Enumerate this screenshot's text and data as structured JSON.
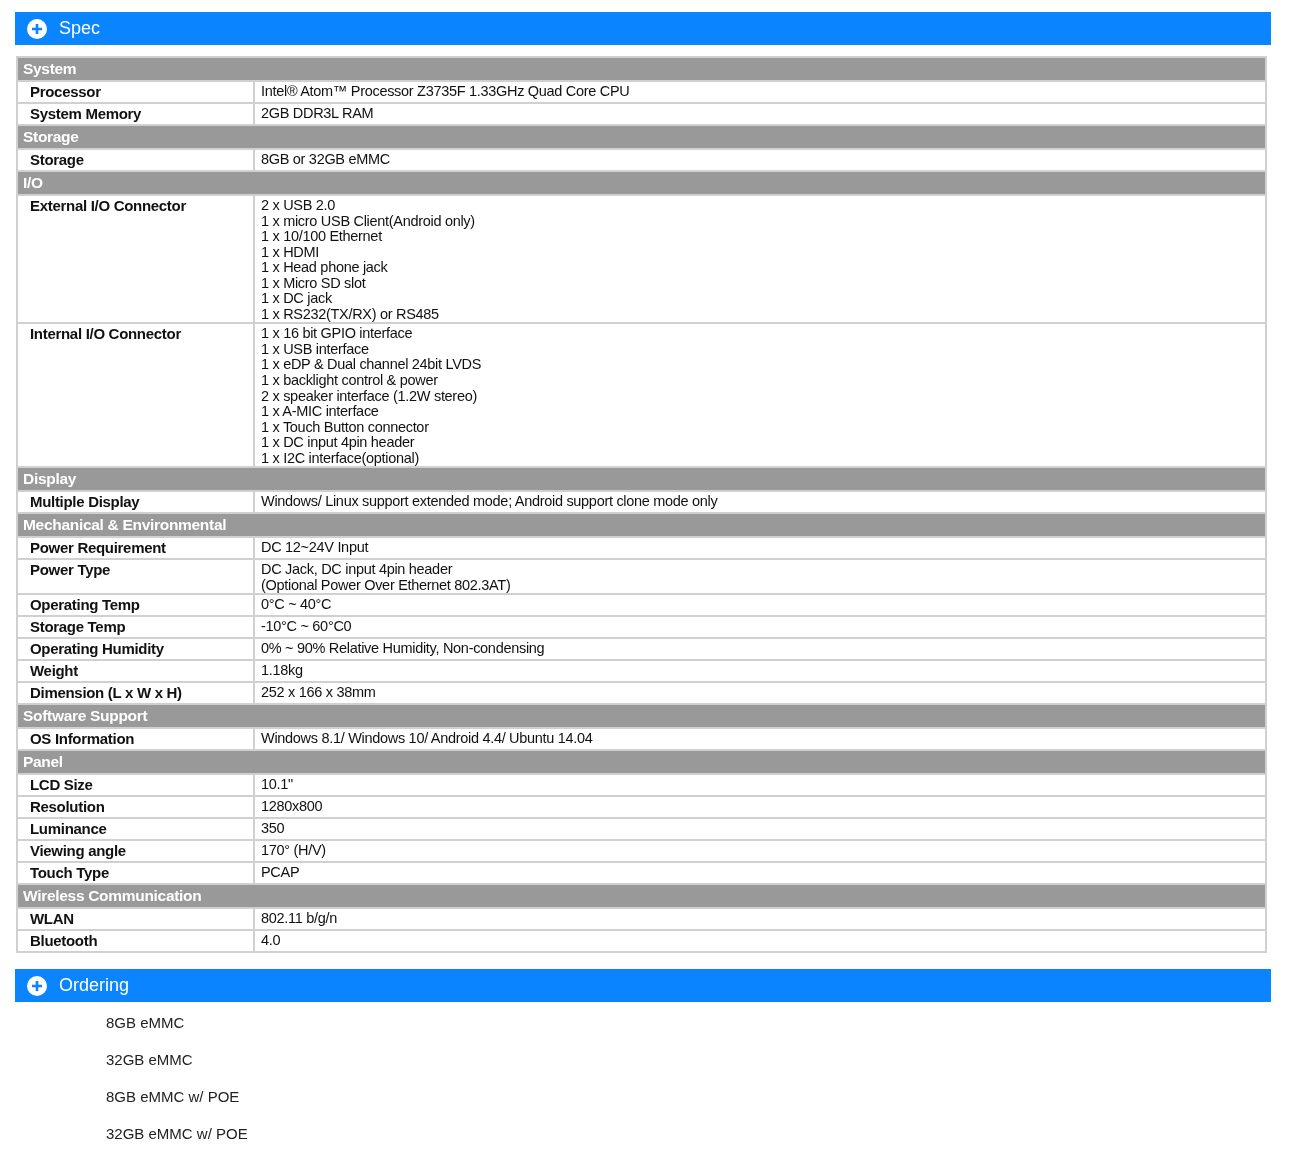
{
  "spec_panel": {
    "title": "Spec",
    "sections": [
      {
        "title": "System",
        "rows": [
          {
            "label": "Processor",
            "lines": [
              "Intel® Atom™ Processor Z3735F 1.33GHz Quad Core CPU"
            ]
          },
          {
            "label": "System Memory",
            "lines": [
              "2GB DDR3L RAM"
            ]
          }
        ]
      },
      {
        "title": "Storage",
        "rows": [
          {
            "label": "Storage",
            "lines": [
              "8GB or 32GB eMMC"
            ]
          }
        ]
      },
      {
        "title": "I/O",
        "rows": [
          {
            "label": "External I/O Connector",
            "lines": [
              "2 x USB 2.0",
              "1 x micro USB Client(Android only)",
              "1 x 10/100 Ethernet",
              "1 x HDMI",
              "1 x Head phone jack",
              "1 x Micro SD slot",
              "1 x DC jack",
              "1 x RS232(TX/RX) or RS485"
            ]
          },
          {
            "label": "Internal I/O Connector",
            "lines": [
              "1 x 16 bit GPIO interface",
              "1 x USB interface",
              "1 x eDP & Dual channel 24bit LVDS",
              "1 x backlight control & power",
              "2 x speaker interface (1.2W stereo)",
              "1 x A-MIC interface",
              "1 x Touch Button connector",
              "1 x DC input 4pin header",
              "1 x I2C interface(optional)"
            ]
          }
        ]
      },
      {
        "title": "Display",
        "rows": [
          {
            "label": "Multiple Display",
            "lines": [
              "Windows/ Linux support extended mode; Android support clone mode only"
            ]
          }
        ]
      },
      {
        "title": "Mechanical & Environmental",
        "rows": [
          {
            "label": "Power Requirement",
            "lines": [
              "DC 12~24V Input"
            ]
          },
          {
            "label": "Power Type",
            "lines": [
              "DC Jack, DC input 4pin header",
              "(Optional Power Over Ethernet 802.3AT)"
            ]
          },
          {
            "label": "Operating Temp",
            "lines": [
              "0°C ~ 40°C"
            ]
          },
          {
            "label": "Storage Temp",
            "lines": [
              "-10°C ~ 60°C0"
            ]
          },
          {
            "label": "Operating Humidity",
            "lines": [
              "0% ~ 90% Relative Humidity, Non-condensing"
            ]
          },
          {
            "label": "Weight",
            "lines": [
              "1.18kg"
            ]
          },
          {
            "label": "Dimension (L x W x H)",
            "lines": [
              "252 x 166 x 38mm"
            ]
          }
        ]
      },
      {
        "title": "Software Support",
        "rows": [
          {
            "label": "OS Information",
            "lines": [
              "Windows 8.1/ Windows 10/ Android 4.4/ Ubuntu 14.04"
            ]
          }
        ]
      },
      {
        "title": "Panel",
        "rows": [
          {
            "label": "LCD Size",
            "lines": [
              "10.1\""
            ]
          },
          {
            "label": "Resolution",
            "lines": [
              "1280x800"
            ]
          },
          {
            "label": "Luminance",
            "lines": [
              "350"
            ]
          },
          {
            "label": "Viewing angle",
            "lines": [
              "170° (H/V)"
            ]
          },
          {
            "label": "Touch Type",
            "lines": [
              "PCAP"
            ]
          }
        ]
      },
      {
        "title": "Wireless Communication",
        "rows": [
          {
            "label": "WLAN",
            "lines": [
              "802.11 b/g/n"
            ]
          },
          {
            "label": "Bluetooth",
            "lines": [
              "4.0"
            ]
          }
        ]
      }
    ]
  },
  "ordering_panel": {
    "title": "Ordering",
    "items": [
      "8GB eMMC",
      "32GB eMMC",
      "8GB eMMC w/ POE",
      "32GB eMMC w/ POE"
    ]
  }
}
